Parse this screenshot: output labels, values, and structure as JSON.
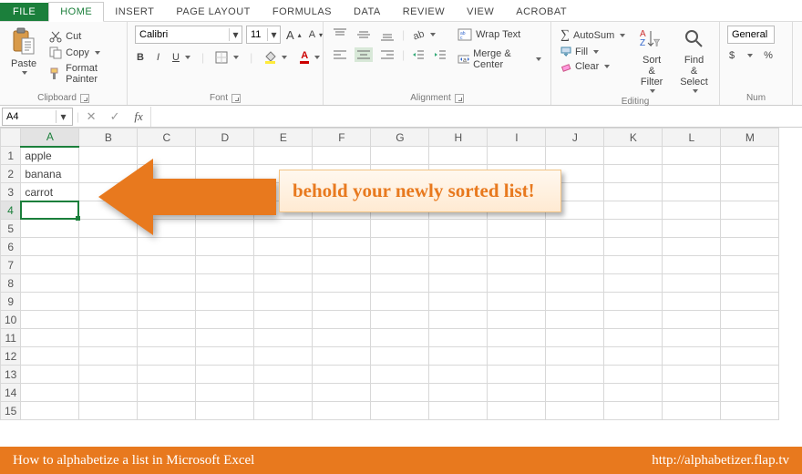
{
  "tabs": {
    "file": "FILE",
    "home": "HOME",
    "insert": "INSERT",
    "pagelayout": "PAGE LAYOUT",
    "formulas": "FORMULAS",
    "data": "DATA",
    "review": "REVIEW",
    "view": "VIEW",
    "acrobat": "ACROBAT"
  },
  "clipboard": {
    "paste": "Paste",
    "cut": "Cut",
    "copy": "Copy",
    "format_painter": "Format Painter",
    "label": "Clipboard"
  },
  "font": {
    "name": "Calibri",
    "size": "11",
    "bold": "B",
    "italic": "I",
    "underline": "U",
    "label": "Font",
    "incA": "A",
    "decA": "A"
  },
  "alignment": {
    "wrap": "Wrap Text",
    "merge": "Merge & Center",
    "label": "Alignment"
  },
  "editing": {
    "autosum": "AutoSum",
    "fill": "Fill",
    "clear": "Clear",
    "sort": "Sort & Filter",
    "find": "Find & Select",
    "label": "Editing"
  },
  "number": {
    "format": "General",
    "currency": "$",
    "percent": "%",
    "label": "Num"
  },
  "formula_bar": {
    "namebox": "A4",
    "fx": "fx",
    "value": ""
  },
  "columns": [
    "A",
    "B",
    "C",
    "D",
    "E",
    "F",
    "G",
    "H",
    "I",
    "J",
    "K",
    "L",
    "M"
  ],
  "rows": 15,
  "cells": {
    "A1": "apple",
    "A2": "banana",
    "A3": "carrot"
  },
  "active_cell": "A4",
  "callout_text": "behold your newly sorted list!",
  "footer": {
    "left": "How to alphabetize a list in Microsoft Excel",
    "right": "http://alphabetizer.flap.tv"
  }
}
